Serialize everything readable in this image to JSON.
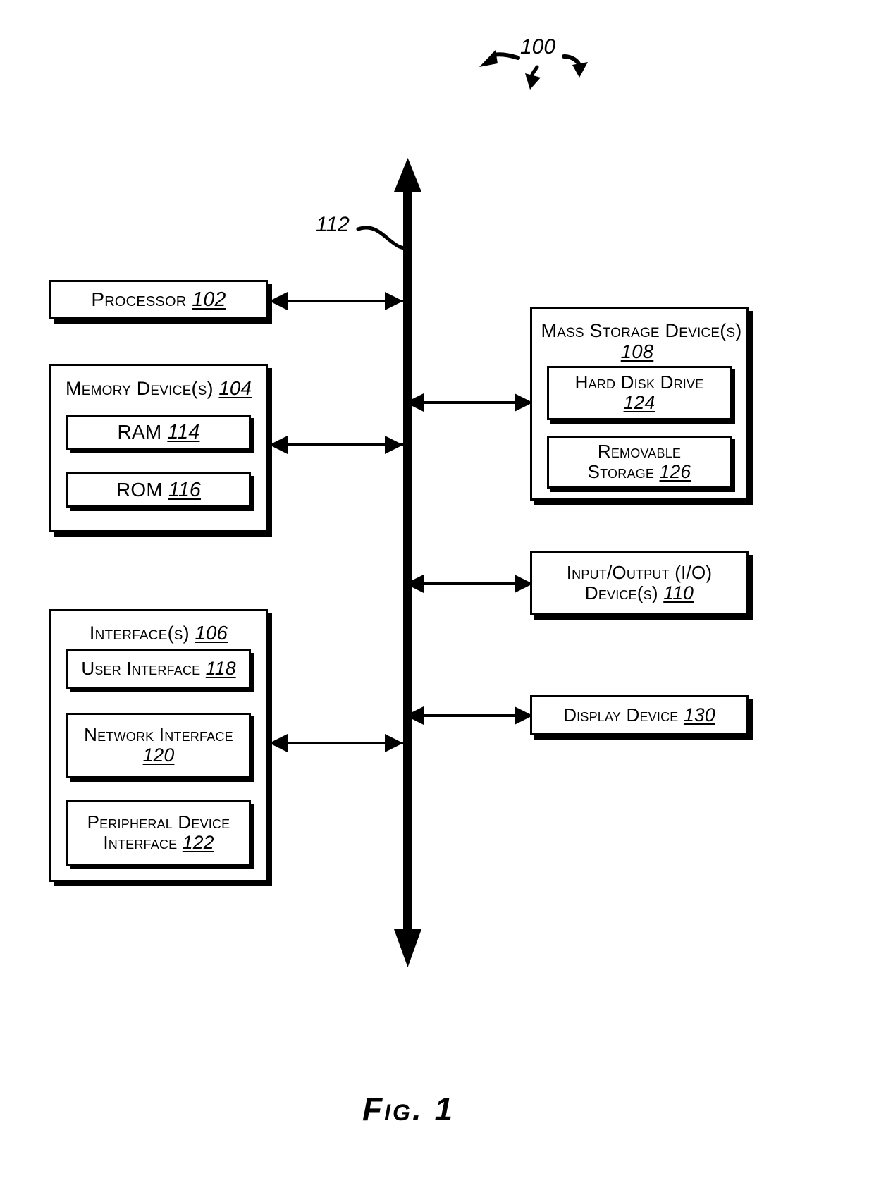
{
  "figure": {
    "caption": "Fig. 1",
    "system_callout": "100",
    "bus_callout": "112"
  },
  "left_blocks": {
    "processor": {
      "label": "Processor",
      "ref": "102"
    },
    "memory": {
      "label": "Memory Device(s)",
      "ref": "104",
      "children": [
        {
          "label": "RAM",
          "ref": "114"
        },
        {
          "label": "ROM",
          "ref": "116"
        }
      ]
    },
    "interfaces": {
      "label": "Interface(s)",
      "ref": "106",
      "children": [
        {
          "label": "User Interface",
          "ref": "118"
        },
        {
          "label": "Network Interface",
          "ref": "120"
        },
        {
          "label": "Peripheral Device Interface",
          "ref": "122"
        }
      ]
    }
  },
  "right_blocks": {
    "mass_storage": {
      "label": "Mass Storage Device(s)",
      "ref": "108",
      "children": [
        {
          "label": "Hard Disk Drive",
          "ref": "124"
        },
        {
          "label": "Removable Storage",
          "ref": "126"
        }
      ]
    },
    "io_devices": {
      "label": "Input/Output (I/O) Device(s)",
      "ref": "110"
    },
    "display_device": {
      "label": "Display Device",
      "ref": "130"
    }
  },
  "colors": {
    "ink": "#000000",
    "paper": "#ffffff"
  }
}
